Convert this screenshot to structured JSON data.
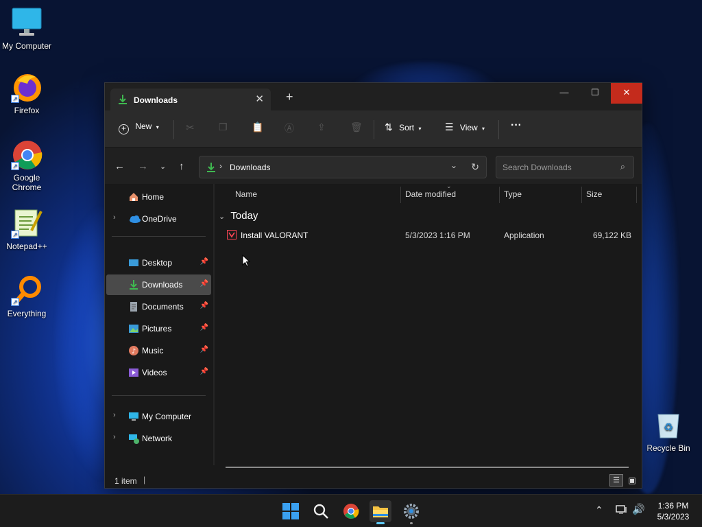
{
  "desktop": {
    "icons": [
      {
        "label": "My Computer"
      },
      {
        "label": "Firefox"
      },
      {
        "label": "Google Chrome"
      },
      {
        "label": "Notepad++"
      },
      {
        "label": "Everything"
      },
      {
        "label": "Recycle Bin"
      }
    ]
  },
  "window": {
    "tab_title": "Downloads",
    "tab_close": "✕",
    "new_tab": "+",
    "controls": {
      "minimize": "—",
      "maximize": "☐",
      "close": "✕"
    }
  },
  "toolbar": {
    "new_label": "New",
    "sort_label": "Sort",
    "view_label": "View",
    "more_label": "···"
  },
  "address": {
    "path": [
      "Downloads"
    ],
    "search_placeholder": "Search Downloads"
  },
  "sidebar": {
    "home": "Home",
    "onedrive": "OneDrive",
    "quick": [
      {
        "label": "Desktop"
      },
      {
        "label": "Downloads",
        "selected": true
      },
      {
        "label": "Documents"
      },
      {
        "label": "Pictures"
      },
      {
        "label": "Music"
      },
      {
        "label": "Videos"
      }
    ],
    "my_computer": "My Computer",
    "network": "Network"
  },
  "files": {
    "columns": [
      "Name",
      "Date modified",
      "Type",
      "Size"
    ],
    "group": "Today",
    "rows": [
      {
        "name": "Install VALORANT",
        "date": "5/3/2023 1:16 PM",
        "type": "Application",
        "size": "69,122 KB"
      }
    ]
  },
  "status": {
    "count": "1 item"
  },
  "taskbar": {
    "clock_time": "1:36 PM",
    "clock_date": "5/3/2023",
    "apps": [
      "start-icon",
      "search-icon",
      "chrome-icon",
      "file-explorer-icon",
      "settings-icon"
    ]
  },
  "colors": {
    "accent_green": "#3fb950",
    "close_red": "#c42b1c",
    "selected": "#4a4a4a"
  }
}
